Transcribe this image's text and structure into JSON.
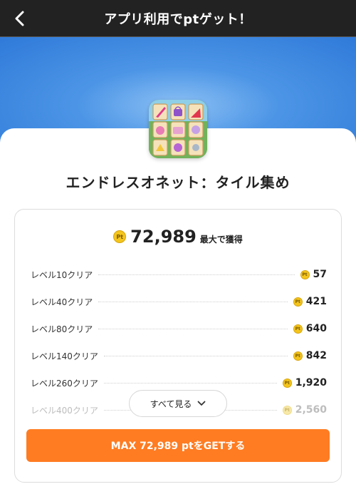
{
  "header": {
    "title": "アプリ利用でptゲット！",
    "back_icon": "chevron-left-icon"
  },
  "app": {
    "title": "エンドレスオネット：タイル集め",
    "icon": "tile-game-app-icon"
  },
  "summary": {
    "coin_label": "Pt",
    "total": "72,989",
    "suffix": "最大で獲得"
  },
  "rewards": [
    {
      "label": "レベル10クリア",
      "value": "57"
    },
    {
      "label": "レベル40クリア",
      "value": "421"
    },
    {
      "label": "レベル80クリア",
      "value": "640"
    },
    {
      "label": "レベル140クリア",
      "value": "842"
    },
    {
      "label": "レベル260クリア",
      "value": "1,920"
    },
    {
      "label": "レベル400クリア",
      "value": "2,560"
    }
  ],
  "see_all": {
    "label": "すべて見る",
    "icon": "chevron-down-icon"
  },
  "cta": {
    "label": "MAX 72,989 ptをGETする",
    "color": "#ff7c22"
  },
  "colors": {
    "topbar": "#222222",
    "hero": "#4c95e6",
    "coin": "#f4c51d"
  }
}
